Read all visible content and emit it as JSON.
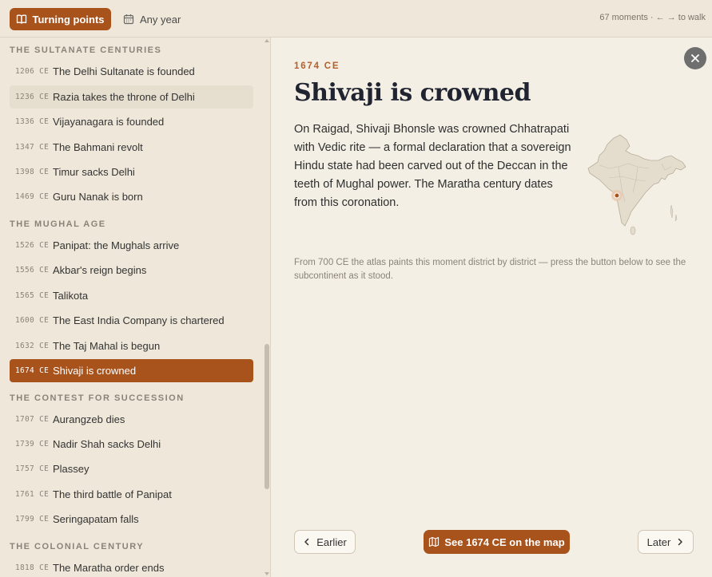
{
  "topbar": {
    "turning_points_label": "Turning points",
    "year_filter_label": "Any year",
    "status": "67 moments · ← → to walk"
  },
  "sidebar": {
    "sections": [
      {
        "title": "THE SULTANATE CENTURIES",
        "events": [
          {
            "year": "1206 CE",
            "title": "The Delhi Sultanate is founded"
          },
          {
            "year": "1236 CE",
            "title": "Razia takes the throne of Delhi"
          },
          {
            "year": "1336 CE",
            "title": "Vijayanagara is founded"
          },
          {
            "year": "1347 CE",
            "title": "The Bahmani revolt"
          },
          {
            "year": "1398 CE",
            "title": "Timur sacks Delhi"
          },
          {
            "year": "1469 CE",
            "title": "Guru Nanak is born"
          }
        ]
      },
      {
        "title": "THE MUGHAL AGE",
        "events": [
          {
            "year": "1526 CE",
            "title": "Panipat: the Mughals arrive"
          },
          {
            "year": "1556 CE",
            "title": "Akbar's reign begins"
          },
          {
            "year": "1565 CE",
            "title": "Talikota"
          },
          {
            "year": "1600 CE",
            "title": "The East India Company is chartered"
          },
          {
            "year": "1632 CE",
            "title": "The Taj Mahal is begun"
          },
          {
            "year": "1674 CE",
            "title": "Shivaji is crowned"
          }
        ]
      },
      {
        "title": "THE CONTEST FOR SUCCESSION",
        "events": [
          {
            "year": "1707 CE",
            "title": "Aurangzeb dies"
          },
          {
            "year": "1739 CE",
            "title": "Nadir Shah sacks Delhi"
          },
          {
            "year": "1757 CE",
            "title": "Plassey"
          },
          {
            "year": "1761 CE",
            "title": "The third battle of Panipat"
          },
          {
            "year": "1799 CE",
            "title": "Seringapatam falls"
          }
        ]
      },
      {
        "title": "THE COLONIAL CENTURY",
        "events": [
          {
            "year": "1818 CE",
            "title": "The Maratha order ends"
          }
        ]
      }
    ]
  },
  "detail": {
    "kicker": "1674 CE",
    "title": "Shivaji is crowned",
    "body": "On Raigad, Shivaji Bhonsle was crowned Chhatrapati with Vedic rite — a formal declaration that a sovereign Hindu state had been carved out of the Deccan in the teeth of Mughal power. The Maratha century dates from this coronation.",
    "note": "From 700 CE the atlas paints this moment district by district — press the button below to see the subcontinent as it stood."
  },
  "footer": {
    "earlier_label": "Earlier",
    "see_map_label": "See 1674 CE on the map",
    "later_label": "Later"
  },
  "colors": {
    "accent": "#a8521c",
    "kicker": "#b5602a",
    "background": "#f4efe5",
    "sidebar": "#efe8da"
  },
  "icons": [
    "book-icon",
    "calendar-icon",
    "close-icon",
    "chevron-left-icon",
    "chevron-right-icon",
    "map-icon"
  ]
}
